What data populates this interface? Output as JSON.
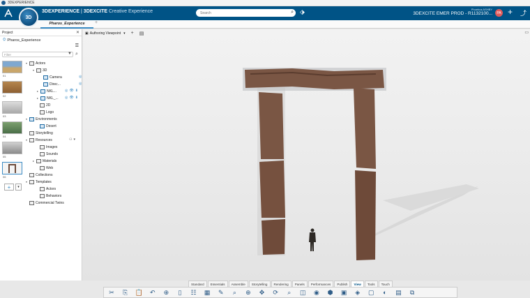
{
  "window": {
    "title": "3DEXPERIENCE"
  },
  "topbar": {
    "brand_bold": "3DEXPERIENCE",
    "brand_sep": " | ",
    "brand_app": "3DEXCITE",
    "brand_sub": "Creative Experience",
    "compass_label": "3D",
    "search_placeholder": "Search",
    "user_name": "Phoebus ASHBY",
    "context": "3DEXCITE EMER PROD - R1132100...",
    "avatar_initials": "PA"
  },
  "tabs": {
    "active": "Pharos_Experience",
    "new_tab": "+"
  },
  "panel": {
    "title": "Project",
    "project_name": "Pharos_Experience",
    "filter_placeholder": "Filter",
    "thumb_numbers": [
      "01",
      "02",
      "03",
      "04",
      "05",
      "06"
    ],
    "add_label": "+"
  },
  "tree": [
    {
      "label": "Actors"
    },
    {
      "label": "3D"
    },
    {
      "label": "Camera"
    },
    {
      "label": "Direc..."
    },
    {
      "label": "NKL..."
    },
    {
      "label": "NKL_..."
    },
    {
      "label": "2D"
    },
    {
      "label": "Logo"
    },
    {
      "label": "Environments"
    },
    {
      "label": "Desert"
    },
    {
      "label": "Storytelling"
    },
    {
      "label": "Resources"
    },
    {
      "label": "Images"
    },
    {
      "label": "Sounds"
    },
    {
      "label": "Materials"
    },
    {
      "label": "Web"
    },
    {
      "label": "Collections"
    },
    {
      "label": "Templates"
    },
    {
      "label": "Actors"
    },
    {
      "label": "Behaviors"
    },
    {
      "label": "Commercial Twins"
    }
  ],
  "viewport": {
    "viewpoint": "Authoring Viewpoint"
  },
  "bottom_tabs": [
    "Standard",
    "Essentials",
    "Assemble",
    "Storytelling",
    "Rendering",
    "Panels",
    "Performances",
    "Publish",
    "View",
    "Tools",
    "Touch"
  ],
  "active_bottom_tab": "View",
  "colors": {
    "topbar": "#005386",
    "accent": "#3a8bc4",
    "stone": "#7a5644"
  },
  "icons": [
    "ds-logo-icon",
    "search-icon",
    "tag-icon",
    "plus-icon",
    "share-icon",
    "close-icon",
    "filter-icon"
  ]
}
